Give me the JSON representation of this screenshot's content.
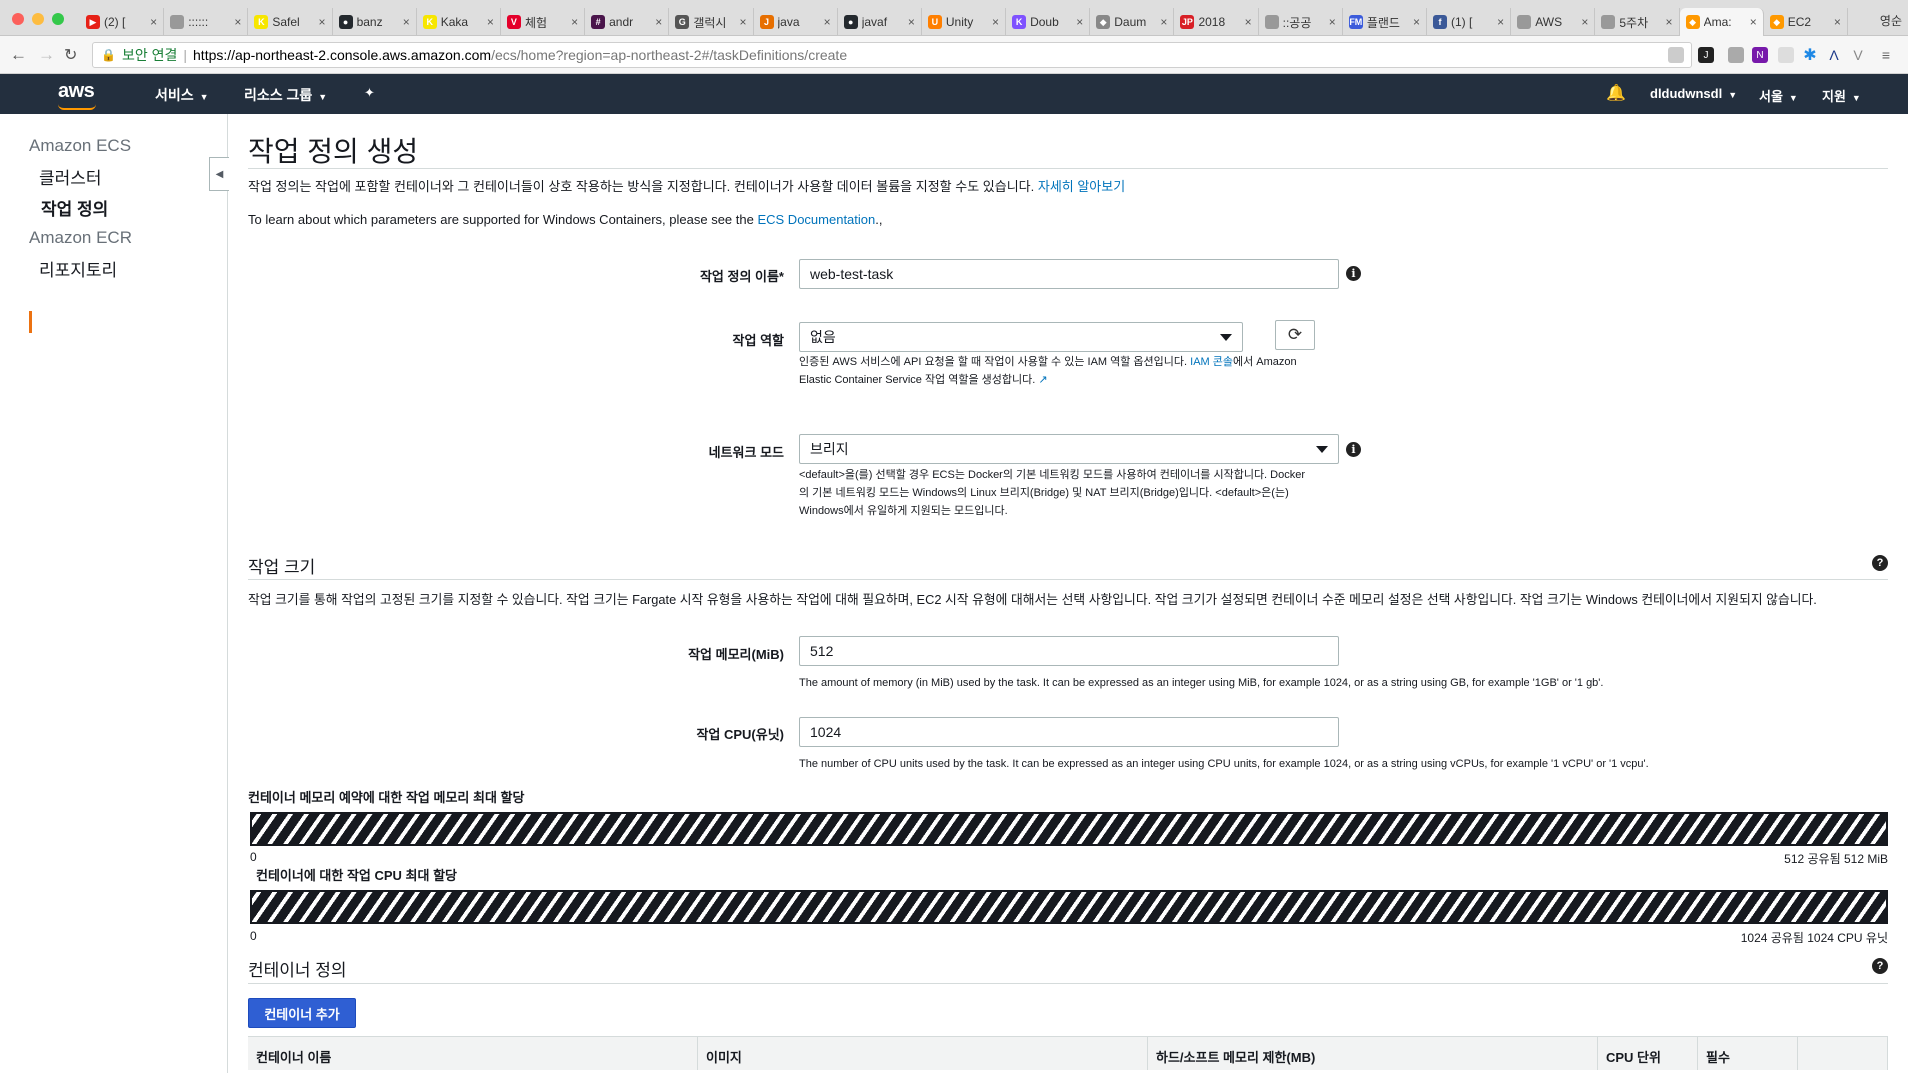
{
  "browser": {
    "tabs": [
      {
        "title": "(2) [",
        "icon": "youtube-icon",
        "color": "#e62117",
        "glyph": "▶"
      },
      {
        "title": "::::::",
        "icon": "page-icon",
        "color": "#999999",
        "glyph": ""
      },
      {
        "title": "Safel",
        "icon": "kakao-icon",
        "color": "#f7e600",
        "glyph": "K"
      },
      {
        "title": "banz",
        "icon": "github-icon",
        "color": "#24292e",
        "glyph": "●"
      },
      {
        "title": "Kaka",
        "icon": "kakao-icon",
        "color": "#f7e600",
        "glyph": "K"
      },
      {
        "title": "체험",
        "icon": "brand-icon",
        "color": "#e4002b",
        "glyph": "V"
      },
      {
        "title": "andr",
        "icon": "slack-icon",
        "color": "#4a154b",
        "glyph": "#"
      },
      {
        "title": "갤럭시",
        "icon": "brand-icon",
        "color": "#555555",
        "glyph": "G"
      },
      {
        "title": "java",
        "icon": "java-icon",
        "color": "#e76f00",
        "glyph": "J"
      },
      {
        "title": "javaf",
        "icon": "github-icon",
        "color": "#24292e",
        "glyph": "●"
      },
      {
        "title": "Unity",
        "icon": "unity-icon",
        "color": "#ff7f00",
        "glyph": "U"
      },
      {
        "title": "Doub",
        "icon": "kotlin-icon",
        "color": "#7f52ff",
        "glyph": "K"
      },
      {
        "title": "Daum",
        "icon": "map-pin-icon",
        "color": "#888888",
        "glyph": "◆"
      },
      {
        "title": "2018",
        "icon": "brand-icon",
        "color": "#d81f26",
        "glyph": "JP"
      },
      {
        "title": "::공공",
        "icon": "page-icon",
        "color": "#999999",
        "glyph": ""
      },
      {
        "title": "플랜드",
        "icon": "brand-icon",
        "color": "#3b5bdb",
        "glyph": "FM"
      },
      {
        "title": "(1) [",
        "icon": "facebook-icon",
        "color": "#3b5998",
        "glyph": "f"
      },
      {
        "title": "AWS",
        "icon": "page-icon",
        "color": "#999999",
        "glyph": ""
      },
      {
        "title": "5주차",
        "icon": "page-icon",
        "color": "#999999",
        "glyph": ""
      },
      {
        "title": "Ama:",
        "icon": "aws-icon",
        "color": "#ff9900",
        "glyph": "◆",
        "active": true
      },
      {
        "title": "EC2",
        "icon": "aws-icon",
        "color": "#ff9900",
        "glyph": "◆"
      }
    ],
    "profile": "영순",
    "secure_label": "보안 연결",
    "url_host": "https://ap-northeast-2.console.aws.amazon.com",
    "url_path": "/ecs/home?region=ap-northeast-2#/taskDefinitions/create"
  },
  "awsnav": {
    "logo": "aws",
    "services": "서비스",
    "resource_groups": "리소스 그룹",
    "pin": "📌",
    "username": "dldudwnsdl",
    "region": "서울",
    "support": "지원"
  },
  "sidebar": {
    "group1": "Amazon ECS",
    "item1": "클러스터",
    "item2": "작업 정의",
    "group2": "Amazon ECR",
    "item3": "리포지토리"
  },
  "main": {
    "title": "작업 정의 생성",
    "intro": "작업 정의는 작업에 포함할 컨테이너와 그 컨테이너들이 상호 작용하는 방식을 지정합니다. 컨테이너가 사용할 데이터 볼륨을 지정할 수도 있습니다.",
    "learn_more": "자세히 알아보기",
    "windows_prefix": "To learn about which parameters are supported for Windows Containers, please see the",
    "ecs_doc_link": "ECS Documentation",
    "windows_suffix": ".,",
    "task_name_label": "작업 정의 이름*",
    "task_name_value": "web-test-task",
    "task_role_label": "작업 역할",
    "task_role_value": "없음",
    "task_role_help_a": "인증된 AWS 서비스에 API 요청을 할 때 작업이 사용할 수 있는 IAM 역할 옵션입니다.",
    "iam_console_link": "IAM 콘솔",
    "task_role_help_b": "에서 Amazon",
    "task_role_help_c": "Elastic Container Service 작업 역할을 생성합니다.",
    "network_label": "네트워크 모드",
    "network_value": "브리지",
    "network_help_1": "<default>을(를) 선택할 경우 ECS는 Docker의 기본 네트워킹 모드를 사용하여 컨테이너를 시작합니다. Docker",
    "network_help_2": "의 기본 네트워킹 모드는 Windows의 Linux 브리지(Bridge) 및 NAT 브리지(Bridge)입니다. <default>은(는)",
    "network_help_3": "Windows에서 유일하게 지원되는 모드입니다.",
    "task_size_title": "작업 크기",
    "task_size_desc": "작업 크기를 통해 작업의 고정된 크기를 지정할 수 있습니다. 작업 크기는 Fargate 시작 유형을 사용하는 작업에 대해 필요하며, EC2 시작 유형에 대해서는 선택 사항입니다. 작업 크기가 설정되면 컨테이너 수준 메모리 설정은 선택 사항입니다. 작업 크기는 Windows 컨테이너에서 지원되지 않습니다.",
    "memory_label": "작업 메모리(MiB)",
    "memory_value": "512",
    "memory_help": "The amount of memory (in MiB) used by the task. It can be expressed as an integer using MiB, for example 1024, or as a string using GB, for example '1GB' or '1 gb'.",
    "cpu_label": "작업 CPU(유닛)",
    "cpu_value": "1024",
    "cpu_help": "The number of CPU units used by the task. It can be expressed as an integer using CPU units, for example 1024, or as a string using vCPUs, for example '1 vCPU' or '1 vcpu'.",
    "mem_alloc_title": "컨테이너 메모리 예약에 대한 작업 메모리 최대 할당",
    "mem_alloc_min": "0",
    "mem_alloc_max": "512 공유됨 512 MiB",
    "cpu_alloc_title": "컨테이너에 대한 작업 CPU 최대 할당",
    "cpu_alloc_min": "0",
    "cpu_alloc_max": "1024 공유됨 1024 CPU 유닛",
    "container_def_title": "컨테이너 정의",
    "add_container": "컨테이너 추가",
    "table_headers": [
      "컨테이너 이름",
      "이미지",
      "하드/소프트 메모리 제한(MB)",
      "CPU 단위",
      "필수",
      ""
    ]
  }
}
